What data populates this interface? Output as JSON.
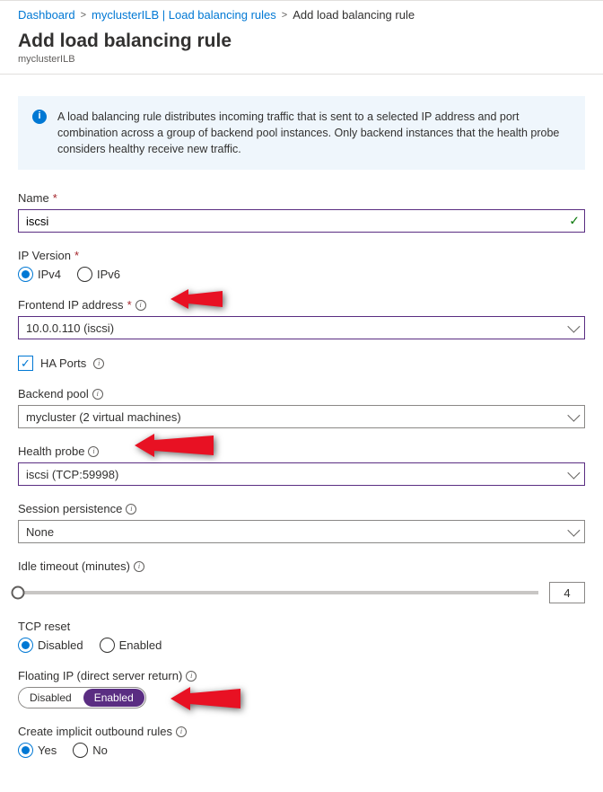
{
  "breadcrumb": {
    "item1": "Dashboard",
    "item2": "myclusterILB | Load balancing rules",
    "item3": "Add load balancing rule"
  },
  "title": "Add load balancing rule",
  "subtitle": "myclusterILB",
  "infobox": "A load balancing rule distributes incoming traffic that is sent to a selected IP address and port combination across a group of backend pool instances. Only backend instances that the health probe considers healthy receive new traffic.",
  "name": {
    "label": "Name",
    "value": "iscsi"
  },
  "ipversion": {
    "label": "IP Version",
    "opt1": "IPv4",
    "opt2": "IPv6"
  },
  "frontend": {
    "label": "Frontend IP address",
    "value": "10.0.0.110 (iscsi)"
  },
  "haports": {
    "label": "HA Ports"
  },
  "backend": {
    "label": "Backend pool",
    "value": "mycluster (2 virtual machines)"
  },
  "healthprobe": {
    "label": "Health probe",
    "value": "iscsi (TCP:59998)"
  },
  "session": {
    "label": "Session persistence",
    "value": "None"
  },
  "idle": {
    "label": "Idle timeout (minutes)",
    "value": "4"
  },
  "tcpreset": {
    "label": "TCP reset",
    "opt1": "Disabled",
    "opt2": "Enabled"
  },
  "floating": {
    "label": "Floating IP (direct server return)",
    "opt1": "Disabled",
    "opt2": "Enabled"
  },
  "outbound": {
    "label": "Create implicit outbound rules",
    "opt1": "Yes",
    "opt2": "No"
  }
}
